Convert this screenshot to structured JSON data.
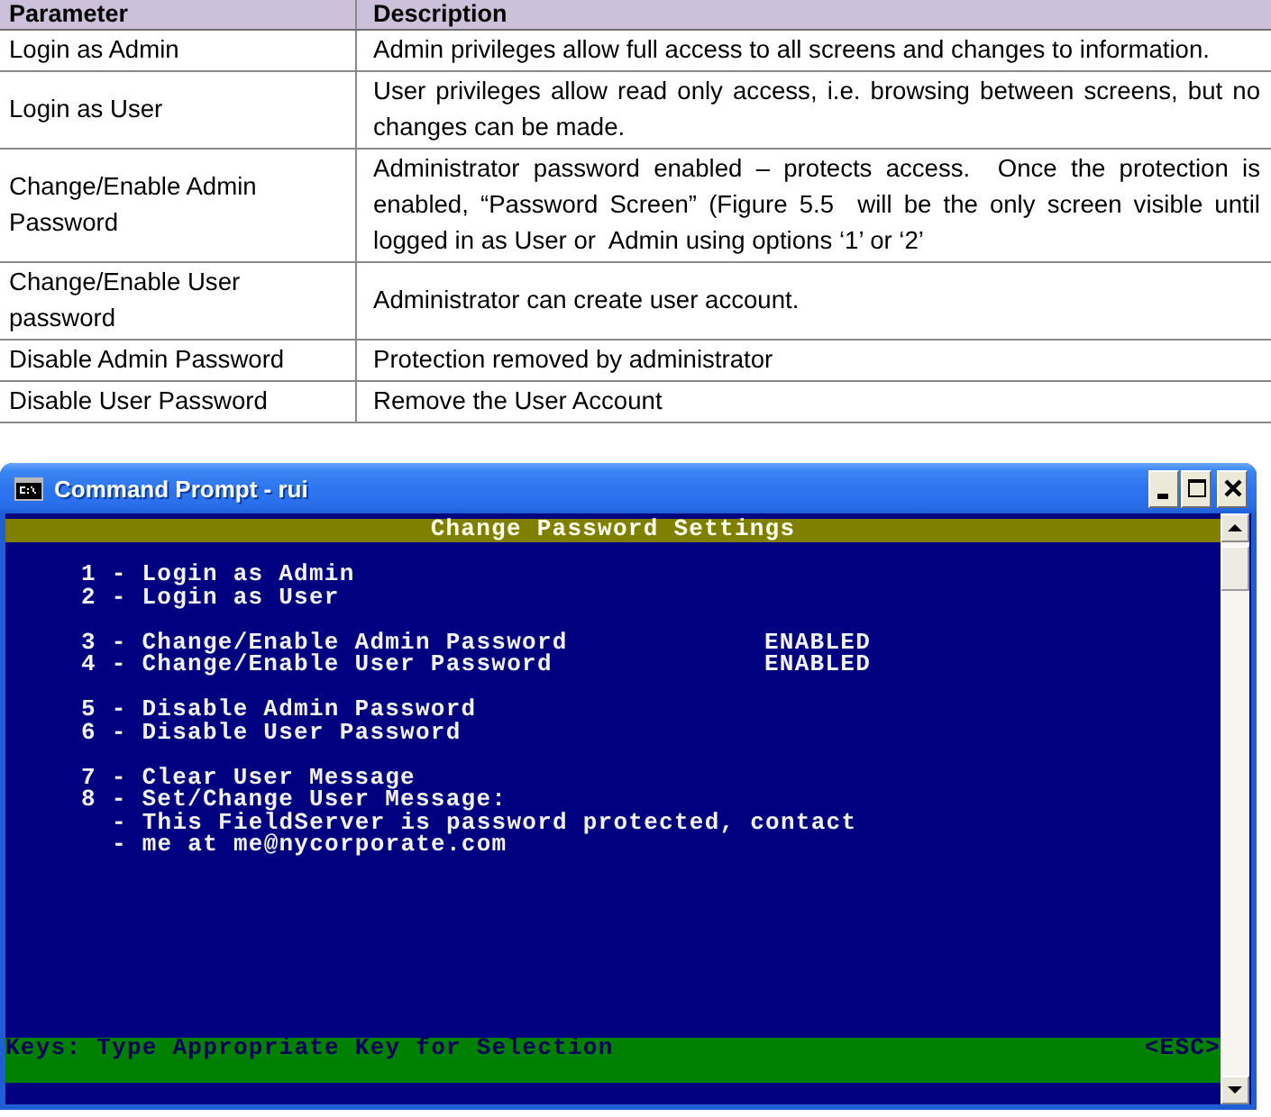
{
  "document_table": {
    "columns": [
      "Parameter",
      "Description"
    ],
    "rows": [
      {
        "parameter": "Login as Admin",
        "description": "Admin privileges allow full access to all screens and changes to information."
      },
      {
        "parameter": "Login as User",
        "description": "User privileges allow read only access, i.e. browsing between screens, but no changes can be made."
      },
      {
        "parameter": "Change/Enable Admin Password",
        "description": "Administrator password enabled – protects access.  Once the protection is enabled, “Password Screen” (Figure 5.5  will be the only screen visible until logged in as User or  Admin using options ‘1’ or ‘2’"
      },
      {
        "parameter": "Change/Enable User password",
        "description": "Administrator can create user account."
      },
      {
        "parameter": "Disable Admin Password",
        "description": "Protection removed by administrator"
      },
      {
        "parameter": "Disable User Password",
        "description": "Remove the User Account"
      }
    ]
  },
  "console_window": {
    "title": "Command Prompt - rui",
    "screen_title": "Change Password Settings",
    "option_groups": [
      {
        "options": [
          {
            "text": "1 - Login as Admin"
          },
          {
            "text": "2 - Login as User"
          }
        ]
      },
      {
        "options": [
          {
            "text": "3 - Change/Enable Admin Password",
            "status": "ENABLED"
          },
          {
            "text": "4 - Change/Enable User Password",
            "status": "ENABLED"
          }
        ]
      },
      {
        "options": [
          {
            "text": "5 - Disable Admin Password"
          },
          {
            "text": "6 - Disable User Password"
          }
        ]
      },
      {
        "options": [
          {
            "text": "7 - Clear User Message"
          },
          {
            "text": "8 - Set/Change User Message:",
            "message_lines": [
              "- This FieldServer is password protected, contact",
              "- me at me@nycorporate.com"
            ]
          }
        ]
      }
    ],
    "keys_bar": {
      "hint": "Keys: Type Appropriate Key for Selection",
      "escape_key": "<ESC>"
    }
  }
}
